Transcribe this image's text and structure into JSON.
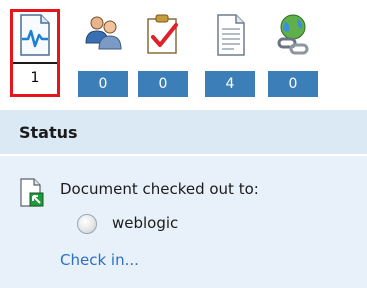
{
  "toolbar": {
    "tools": [
      {
        "icon": "activity-chart-icon",
        "count": "1",
        "selected": true
      },
      {
        "icon": "users-icon",
        "count": "0"
      },
      {
        "icon": "checklist-icon",
        "count": "0"
      },
      {
        "icon": "document-icon",
        "count": "4"
      },
      {
        "icon": "globe-link-icon",
        "count": "0"
      }
    ]
  },
  "status": {
    "title": "Status",
    "checked_out_label": "Document checked out to:",
    "user": "weblogic",
    "check_in_link": "Check in..."
  },
  "colors": {
    "selected_border": "#e8141c",
    "count_bar": "#3c7fb8",
    "panel_bg": "#dbe9f5",
    "link": "#2d6fc4"
  }
}
